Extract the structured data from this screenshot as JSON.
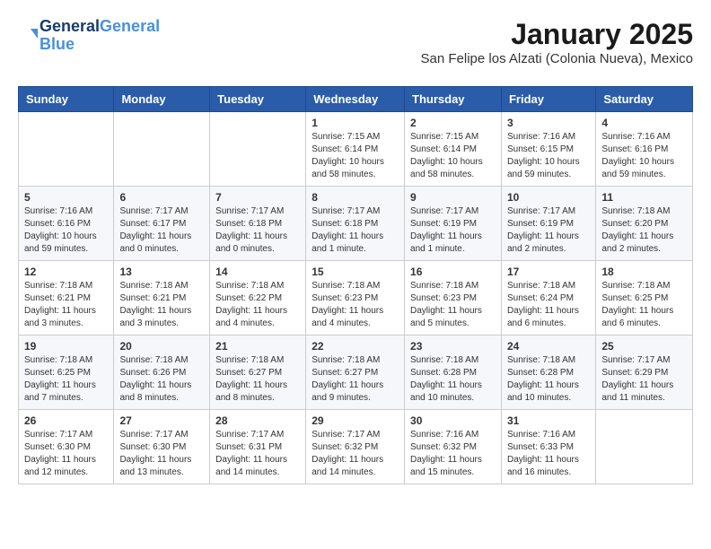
{
  "logo": {
    "line1": "General",
    "line2": "Blue"
  },
  "title": "January 2025",
  "subtitle": "San Felipe los Alzati (Colonia Nueva), Mexico",
  "weekdays": [
    "Sunday",
    "Monday",
    "Tuesday",
    "Wednesday",
    "Thursday",
    "Friday",
    "Saturday"
  ],
  "weeks": [
    [
      {
        "day": "",
        "sunrise": "",
        "sunset": "",
        "daylight": ""
      },
      {
        "day": "",
        "sunrise": "",
        "sunset": "",
        "daylight": ""
      },
      {
        "day": "",
        "sunrise": "",
        "sunset": "",
        "daylight": ""
      },
      {
        "day": "1",
        "sunrise": "Sunrise: 7:15 AM",
        "sunset": "Sunset: 6:14 PM",
        "daylight": "Daylight: 10 hours and 58 minutes."
      },
      {
        "day": "2",
        "sunrise": "Sunrise: 7:15 AM",
        "sunset": "Sunset: 6:14 PM",
        "daylight": "Daylight: 10 hours and 58 minutes."
      },
      {
        "day": "3",
        "sunrise": "Sunrise: 7:16 AM",
        "sunset": "Sunset: 6:15 PM",
        "daylight": "Daylight: 10 hours and 59 minutes."
      },
      {
        "day": "4",
        "sunrise": "Sunrise: 7:16 AM",
        "sunset": "Sunset: 6:16 PM",
        "daylight": "Daylight: 10 hours and 59 minutes."
      }
    ],
    [
      {
        "day": "5",
        "sunrise": "Sunrise: 7:16 AM",
        "sunset": "Sunset: 6:16 PM",
        "daylight": "Daylight: 10 hours and 59 minutes."
      },
      {
        "day": "6",
        "sunrise": "Sunrise: 7:17 AM",
        "sunset": "Sunset: 6:17 PM",
        "daylight": "Daylight: 11 hours and 0 minutes."
      },
      {
        "day": "7",
        "sunrise": "Sunrise: 7:17 AM",
        "sunset": "Sunset: 6:18 PM",
        "daylight": "Daylight: 11 hours and 0 minutes."
      },
      {
        "day": "8",
        "sunrise": "Sunrise: 7:17 AM",
        "sunset": "Sunset: 6:18 PM",
        "daylight": "Daylight: 11 hours and 1 minute."
      },
      {
        "day": "9",
        "sunrise": "Sunrise: 7:17 AM",
        "sunset": "Sunset: 6:19 PM",
        "daylight": "Daylight: 11 hours and 1 minute."
      },
      {
        "day": "10",
        "sunrise": "Sunrise: 7:17 AM",
        "sunset": "Sunset: 6:19 PM",
        "daylight": "Daylight: 11 hours and 2 minutes."
      },
      {
        "day": "11",
        "sunrise": "Sunrise: 7:18 AM",
        "sunset": "Sunset: 6:20 PM",
        "daylight": "Daylight: 11 hours and 2 minutes."
      }
    ],
    [
      {
        "day": "12",
        "sunrise": "Sunrise: 7:18 AM",
        "sunset": "Sunset: 6:21 PM",
        "daylight": "Daylight: 11 hours and 3 minutes."
      },
      {
        "day": "13",
        "sunrise": "Sunrise: 7:18 AM",
        "sunset": "Sunset: 6:21 PM",
        "daylight": "Daylight: 11 hours and 3 minutes."
      },
      {
        "day": "14",
        "sunrise": "Sunrise: 7:18 AM",
        "sunset": "Sunset: 6:22 PM",
        "daylight": "Daylight: 11 hours and 4 minutes."
      },
      {
        "day": "15",
        "sunrise": "Sunrise: 7:18 AM",
        "sunset": "Sunset: 6:23 PM",
        "daylight": "Daylight: 11 hours and 4 minutes."
      },
      {
        "day": "16",
        "sunrise": "Sunrise: 7:18 AM",
        "sunset": "Sunset: 6:23 PM",
        "daylight": "Daylight: 11 hours and 5 minutes."
      },
      {
        "day": "17",
        "sunrise": "Sunrise: 7:18 AM",
        "sunset": "Sunset: 6:24 PM",
        "daylight": "Daylight: 11 hours and 6 minutes."
      },
      {
        "day": "18",
        "sunrise": "Sunrise: 7:18 AM",
        "sunset": "Sunset: 6:25 PM",
        "daylight": "Daylight: 11 hours and 6 minutes."
      }
    ],
    [
      {
        "day": "19",
        "sunrise": "Sunrise: 7:18 AM",
        "sunset": "Sunset: 6:25 PM",
        "daylight": "Daylight: 11 hours and 7 minutes."
      },
      {
        "day": "20",
        "sunrise": "Sunrise: 7:18 AM",
        "sunset": "Sunset: 6:26 PM",
        "daylight": "Daylight: 11 hours and 8 minutes."
      },
      {
        "day": "21",
        "sunrise": "Sunrise: 7:18 AM",
        "sunset": "Sunset: 6:27 PM",
        "daylight": "Daylight: 11 hours and 8 minutes."
      },
      {
        "day": "22",
        "sunrise": "Sunrise: 7:18 AM",
        "sunset": "Sunset: 6:27 PM",
        "daylight": "Daylight: 11 hours and 9 minutes."
      },
      {
        "day": "23",
        "sunrise": "Sunrise: 7:18 AM",
        "sunset": "Sunset: 6:28 PM",
        "daylight": "Daylight: 11 hours and 10 minutes."
      },
      {
        "day": "24",
        "sunrise": "Sunrise: 7:18 AM",
        "sunset": "Sunset: 6:28 PM",
        "daylight": "Daylight: 11 hours and 10 minutes."
      },
      {
        "day": "25",
        "sunrise": "Sunrise: 7:17 AM",
        "sunset": "Sunset: 6:29 PM",
        "daylight": "Daylight: 11 hours and 11 minutes."
      }
    ],
    [
      {
        "day": "26",
        "sunrise": "Sunrise: 7:17 AM",
        "sunset": "Sunset: 6:30 PM",
        "daylight": "Daylight: 11 hours and 12 minutes."
      },
      {
        "day": "27",
        "sunrise": "Sunrise: 7:17 AM",
        "sunset": "Sunset: 6:30 PM",
        "daylight": "Daylight: 11 hours and 13 minutes."
      },
      {
        "day": "28",
        "sunrise": "Sunrise: 7:17 AM",
        "sunset": "Sunset: 6:31 PM",
        "daylight": "Daylight: 11 hours and 14 minutes."
      },
      {
        "day": "29",
        "sunrise": "Sunrise: 7:17 AM",
        "sunset": "Sunset: 6:32 PM",
        "daylight": "Daylight: 11 hours and 14 minutes."
      },
      {
        "day": "30",
        "sunrise": "Sunrise: 7:16 AM",
        "sunset": "Sunset: 6:32 PM",
        "daylight": "Daylight: 11 hours and 15 minutes."
      },
      {
        "day": "31",
        "sunrise": "Sunrise: 7:16 AM",
        "sunset": "Sunset: 6:33 PM",
        "daylight": "Daylight: 11 hours and 16 minutes."
      },
      {
        "day": "",
        "sunrise": "",
        "sunset": "",
        "daylight": ""
      }
    ]
  ]
}
